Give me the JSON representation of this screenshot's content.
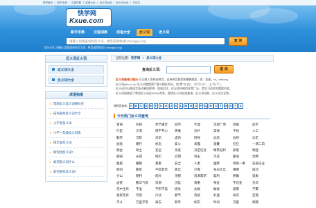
{
  "topbar": {
    "links": [
      "快学首页",
      "新华字典",
      "汉语词典",
      "成语大全",
      "近义词大全",
      "反义词大全",
      "古诗文"
    ]
  },
  "logo": {
    "name": "快学网",
    "domain": "Kxue.com"
  },
  "nav": {
    "items": [
      "新华字典",
      "汉语词典",
      "成语大全",
      "反义词",
      "近义词"
    ]
  },
  "search": {
    "placeholder": "请输入您要查询的反义词，拼音或简称(如:zhongguo,zg)",
    "button": "查 询",
    "hint": "提示方式: 请输入您要查询的汉字词，拼音或简称(如: zhongguo,zg)"
  },
  "sidebar": {
    "links_box": {
      "title": "近义词反义词",
      "items": [
        "近义词大全",
        "反义词大全"
      ]
    },
    "guide_box": {
      "title": "成语指南",
      "items": [
        "帮助近义反义词网对对",
        "成语查找反义词大全",
        "小学考反义词",
        "小学一年级反义词练",
        "四年级反义词",
        "如何找反义词?",
        "如何反义词什么",
        "如何查找反义词?"
      ]
    }
  },
  "main": {
    "breadcrumb": {
      "label": "当前位置:",
      "home": "快学网",
      "sep": ">",
      "current": "反义词大全"
    },
    "search": {
      "label": "查询反义词:",
      "button": "查 询"
    },
    "tips": {
      "title": "反义词查询小提示:",
      "lines": [
        "可以输入简称或拼音，支持拼音搜索和模糊搜索，如：悲痛，bt，beitong",
        "反义词(fǎn yì cí): 反义词就是两个意义相反的词，如“黑”与“白”、“大”与“小”、“上”与“下”。",
        "反义词可以使语言表达更加鲜明，加强对比，在汉语中使用非常广泛，是学习语文的重要内容。",
        "反义词网收录了常用反义词近20000余条，提供反义词在线查询，反义词词典，反义词大全等。"
      ]
    },
    "letters": {
      "label": "按拼音查询:",
      "items": [
        "A",
        "B",
        "C",
        "D",
        "E",
        "F",
        "G",
        "H",
        "J",
        "K",
        "L",
        "M",
        "N",
        "O",
        "P",
        "Q",
        "R",
        "S",
        "T",
        "W",
        "X",
        "Y",
        "Z"
      ]
    },
    "hot": {
      "title": "今日热门反义词查询",
      "words": [
        [
          "富丽",
          "有钱",
          "季节重定",
          "城市",
          "代理",
          "见闻广博",
          "后援",
          "徒步"
        ],
        [
          "伶是",
          "冷漠",
          "目不专心",
          "勇敢",
          "古朴",
          "美丽",
          "干枯",
          "人工"
        ],
        [
          "勤劳",
          "沉默",
          "忍卒",
          "虚伪",
          "轻视",
          "凶恶",
          "凶残",
          "淡定"
        ],
        [
          "加宽",
          "模行",
          "依态",
          "安心",
          "表露",
          "温馨",
          "红红",
          "一清二白"
        ],
        [
          "明台",
          "奇士",
          "安全",
          "亲爱",
          "决定信念",
          "精茶纪料",
          "邪意",
          "跨越"
        ],
        [
          "脚弱",
          "长城",
          "经历",
          "忍惧",
          "攻击",
          "乃美",
          "鄙弱",
          "奔腾"
        ],
        [
          "瘦肥",
          "朦胧",
          "重重",
          "安全",
          "人类",
          "幽默",
          "顿饭一事",
          "安居乐业"
        ],
        [
          "刚创",
          "繁星",
          "不得其笑",
          "真实",
          "冷悔",
          "冬必信实",
          "细明",
          "成功"
        ],
        [
          "尖山",
          "随利",
          "成长",
          "顶部",
          "资源需求",
          "聪利",
          "明确",
          "说服"
        ],
        [
          "虚妄",
          "繁华气等",
          "资源",
          "沉挂",
          "真重",
          "保证",
          "不忘变",
          "亲次"
        ],
        [
          "无中生有",
          "不准",
          "不积不美",
          "损失",
          "女娲",
          "敏衰",
          "富愚",
          "学雾"
        ],
        [
          "发家无有",
          "可惜",
          "冷淡",
          "春节",
          "资质",
          "扑面",
          "知识",
          "空落"
        ],
        [
          "平斗",
          "万里平常",
          "离去",
          "新年",
          "如实",
          "时间",
          "沉著",
          "辉煌"
        ]
      ]
    }
  },
  "colors": {
    "header_blue": "#2e8fdb",
    "nav_active": "#f7b84a",
    "button_orange": "#f39a1e",
    "link_blue": "#1d5a96"
  }
}
